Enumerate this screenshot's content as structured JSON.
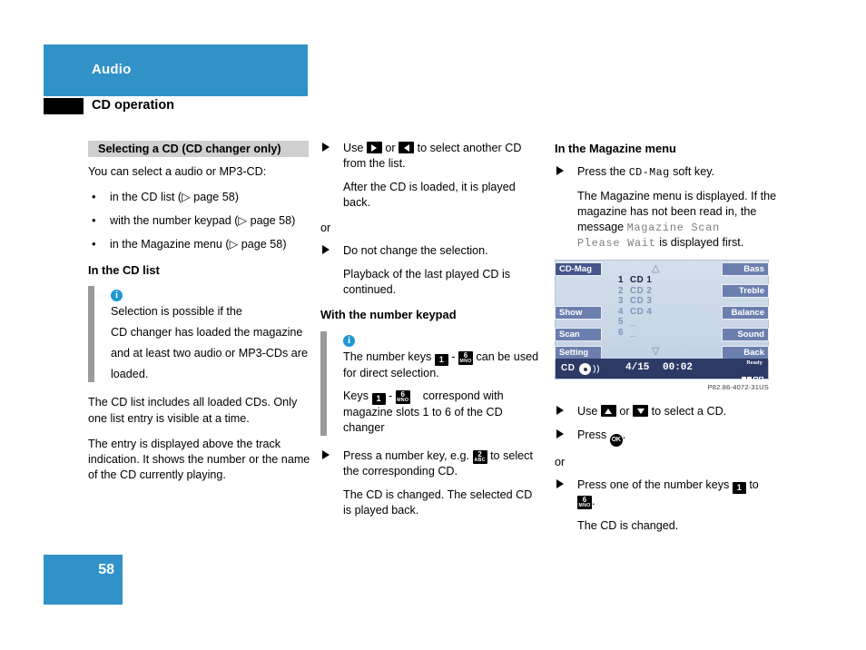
{
  "header": {
    "title": "Audio",
    "subtitle": "CD operation"
  },
  "footer": {
    "page_number": "58"
  },
  "col1": {
    "section_heading": "Selecting a CD (CD changer only)",
    "intro": "You can select a audio or MP3-CD:",
    "bullets": [
      "in the CD list (▷ page 58)",
      "with the number keypad (▷ page 58)",
      "in the Magazine menu (▷ page 58)"
    ],
    "subheading": "In the CD list",
    "note": [
      "Selection is possible if the",
      "CD changer has loaded the magazine",
      "and at least two audio or MP3-CDs are",
      "loaded."
    ],
    "para1": "The CD list includes all loaded CDs. Only one list entry is visible at a time.",
    "para2": "The entry is displayed above the track indication. It shows the number or the name of the CD currently playing."
  },
  "col2": {
    "step1_pre": "Use",
    "step1_mid": "or",
    "step1_post": "to select another CD from the list.",
    "step1_result": "After the CD is loaded, it is played back.",
    "or": "or",
    "step2": "Do not change the selection.",
    "step2_result": "Playback of the last played CD is continued.",
    "subheading": "With the number keypad",
    "note_line1_a": "The number keys",
    "note_line1_dash": "-",
    "note_line1_b": "can be used for direct selection.",
    "note_line2_a": "Keys",
    "note_line2_dash": "-",
    "note_line2_b": "correspond with magazine slots 1 to 6 of the CD changer",
    "step3_a": "Press a number key, e.g.",
    "step3_b": "to select the corresponding CD.",
    "step3_result": "The CD is changed. The selected CD is played back."
  },
  "col3": {
    "subheading": "In the Magazine menu",
    "step1_a": "Press the",
    "step1_key": "CD-Mag",
    "step1_b": "soft key.",
    "step1_result_a": "The Magazine menu is displayed. If the magazine has not been read in, the message",
    "step1_result_mono1": "Magazine Scan",
    "step1_result_mono2": "Please Wait",
    "step1_result_b": "is displayed first.",
    "step2_a": "Use",
    "step2_mid": "or",
    "step2_b": "to select a CD.",
    "step3_a": "Press",
    "step3_b": ".",
    "or": "or",
    "step4_a": "Press one of the number keys",
    "step4_mid": "to",
    "step4_b": ".",
    "step4_result": "The CD is changed."
  },
  "display": {
    "caption": "P82.86-4072-31US",
    "softkeys_left": [
      "CD-Mag",
      "Show",
      "Scan",
      "Setting"
    ],
    "softkeys_right": [
      "Bass",
      "Treble",
      "Balance",
      "Sound",
      "Back"
    ],
    "scroll_up_icon": "△",
    "scroll_down_icon": "▽",
    "cd_list": [
      {
        "num": "1",
        "title": "CD 1",
        "selected": true
      },
      {
        "num": "2",
        "title": "CD 2",
        "selected": false
      },
      {
        "num": "3",
        "title": "CD 3",
        "selected": false
      },
      {
        "num": "4",
        "title": "CD 4",
        "selected": false
      },
      {
        "num": "5",
        "title": "_",
        "selected": false
      },
      {
        "num": "6",
        "title": "_",
        "selected": false
      }
    ],
    "status": {
      "source": "CD",
      "track": "4/15",
      "time": "00:02",
      "ready_label": "Ready"
    }
  },
  "colors": {
    "brand_blue": "#3192c8",
    "info_blue": "#2196d4",
    "display_bg": "#c6d4e4",
    "softkey": "#6a7fad",
    "statusbar": "#2c3a66",
    "section_gray": "#cfcfcf",
    "rule_gray": "#9a9a9a"
  }
}
